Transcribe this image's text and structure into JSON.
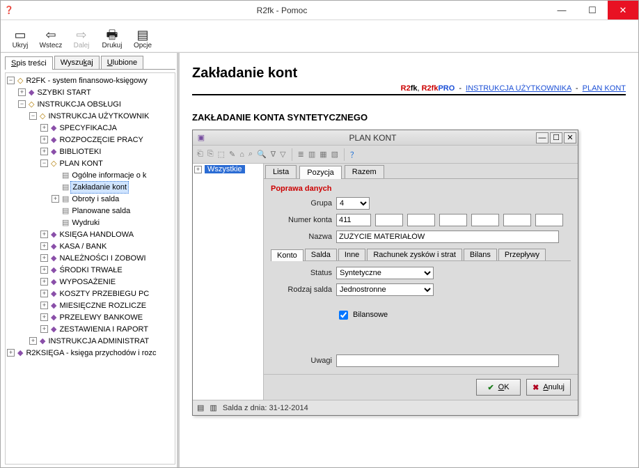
{
  "app": {
    "title": "R2fk - Pomoc",
    "toolbar": {
      "hide": "Ukryj",
      "back": "Wstecz",
      "forward": "Dalej",
      "print": "Drukuj",
      "options": "Opcje"
    }
  },
  "nav_tabs": {
    "contents": "Spis treści",
    "search": "Wyszukaj",
    "favorites": "Ulubione"
  },
  "tree": {
    "root1": "R2FK - system finansowo-księgowy",
    "szybki_start": "SZYBKI START",
    "instrukcja_obslugi": "INSTRUKCJA OBSŁUGI",
    "instrukcja_uzytkownika": "INSTRUKCJA UŻYTKOWNIK",
    "specyfikacja": "SPECYFIKACJA",
    "rozpoczecie_pracy": "ROZPOCZĘCIE PRACY",
    "biblioteki": "BIBLIOTEKI",
    "plan_kont": "PLAN KONT",
    "ogolne_informacje": "Ogólne informacje o k",
    "zakladanie_kont": "Zakładanie kont",
    "obroty_i_salda": "Obroty i salda",
    "planowane_salda": "Planowane salda",
    "wydruki": "Wydruki",
    "ksiega_handlowa": "KSIĘGA HANDLOWA",
    "kasa_bank": "KASA / BANK",
    "naleznosci_i_zobowi": "NALEŻNOŚCI I ZOBOWI",
    "srodki_trwale": "ŚRODKI TRWAŁE",
    "wyposazenie": "WYPOSAŻENIE",
    "koszty_przebiegu": "KOSZTY PRZEBIEGU PC",
    "miesieczne_rozlicze": "MIESIĘCZNE ROZLICZE",
    "przelewy_bankowe": "PRZELEWY BANKOWE",
    "zestawienia_i_raporty": "ZESTAWIENIA I RAPORT",
    "instrukcja_administrat": "INSTRUKCJA ADMINISTRAT",
    "r2ksiega": "R2KSIĘGA - księga przychodów i rozc"
  },
  "page": {
    "h1": "Zakładanie kont",
    "brand_r2fk": "R2fk",
    "brand_r2fkpro_r": "R2fk",
    "brand_r2fkpro_p": "PRO",
    "link_instrukcja": "INSTRUKCJA UŻYTKOWNIKA",
    "link_plan_kont": "PLAN KONT",
    "section_title": "ZAKŁADANIE KONTA SYNTETYCZNEGO"
  },
  "dialog": {
    "title": "PLAN KONT",
    "left_root": "Wszystkie",
    "tabs": {
      "lista": "Lista",
      "pozycja": "Pozycja",
      "razem": "Razem"
    },
    "section_header": "Poprawa danych",
    "labels": {
      "grupa": "Grupa",
      "numer_konta": "Numer konta",
      "nazwa": "Nazwa",
      "status": "Status",
      "rodzaj_salda": "Rodzaj salda",
      "bilansowe": "Bilansowe",
      "uwagi": "Uwagi"
    },
    "values": {
      "grupa": "4",
      "numer_konta": "411",
      "nazwa": "ZUŻYCIE MATERIAŁÓW",
      "status": "Syntetyczne",
      "rodzaj_salda": "Jednostronne",
      "uwagi": ""
    },
    "subtabs": {
      "konto": "Konto",
      "salda": "Salda",
      "inne": "Inne",
      "rach": "Rachunek zysków i strat",
      "bilans": "Bilans",
      "przeplywy": "Przepływy"
    },
    "buttons": {
      "ok": "OK",
      "anuluj": "Anuluj"
    },
    "status": "Salda z dnia: 31-12-2014"
  }
}
